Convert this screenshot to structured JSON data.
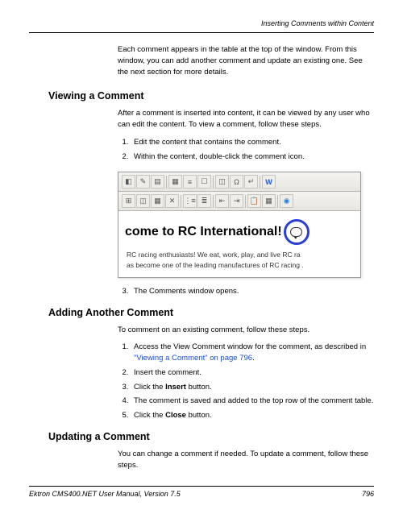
{
  "header": {
    "running_title": "Inserting Comments within Content"
  },
  "sections": {
    "intro": "Each comment appears in the table at the top of the window. From this window, you can add another comment and update an existing one. See the next section for more details.",
    "viewing": {
      "heading": "Viewing a Comment",
      "lead": "After a comment is inserted into content, it can be viewed by any user who can edit the content. To view a comment, follow these steps.",
      "steps_a": [
        "Edit the content that contains the comment.",
        "Within the content, double-click the comment icon."
      ],
      "steps_b": [
        "The Comments window opens."
      ]
    },
    "editor_sample": {
      "headline": "come to RC International!",
      "body1": "RC racing enthusiasts! We eat, work, play, and live RC ra",
      "body2": "as become one of the leading manufactures of RC racing ."
    },
    "adding": {
      "heading": "Adding Another Comment",
      "lead": "To comment on an existing comment, follow these steps.",
      "steps": [
        {
          "pre": "Access the View Comment window for the comment, as described in ",
          "xref": "\"Viewing a Comment\" on page 796",
          "post": "."
        },
        {
          "text": "Insert the comment."
        },
        {
          "pre": "Click the ",
          "bold": "Insert",
          "post": " button."
        },
        {
          "text": "The comment is saved and added to the top row of the comment table."
        },
        {
          "pre": "Click the ",
          "bold": "Close",
          "post": " button."
        }
      ]
    },
    "updating": {
      "heading": "Updating a Comment",
      "lead": "You can change a comment if needed. To update a comment, follow these steps."
    }
  },
  "footer": {
    "left": "Ektron CMS400.NET User Manual, Version 7.5",
    "page": "796"
  }
}
